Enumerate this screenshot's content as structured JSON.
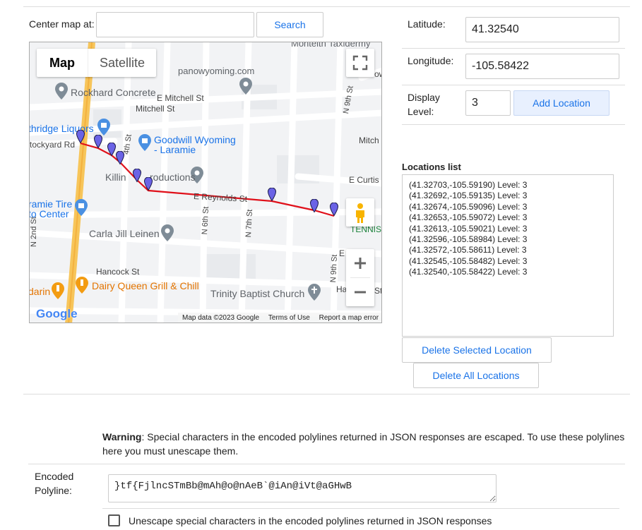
{
  "search": {
    "label": "Center map at:",
    "value": "",
    "button": "Search"
  },
  "map": {
    "tabs": [
      "Map",
      "Satellite"
    ],
    "places": [
      "Monteith Taxidermy",
      "panowyoming.com",
      "Rockhard Concrete",
      "E Mitchell St",
      "Mitchell St",
      "Goodwill Wyoming",
      "- Laramie",
      "thridge Liquors",
      "tockyard Rd",
      "Killin",
      "roductions",
      "E Curtis",
      "E Reynolds St",
      "ramie Tire",
      "to Center",
      "Carla Jill Leinen",
      "Hancock St",
      "Dairy Queen Grill & Chill",
      "darin",
      "Trinity Baptist Church",
      "TENNIS",
      "N 9th St",
      "N 6th St",
      "N 7th St",
      "N 9th St",
      "Mitch",
      "4th St",
      "N 2nd St",
      "E",
      "Ha",
      "St",
      "ow"
    ],
    "google_logo": "Google",
    "footer": [
      "Map data ©2023 Google",
      "Terms of Use",
      "Report a map error"
    ]
  },
  "form": {
    "lat_label": "Latitude:",
    "lat_value": "41.32540",
    "lng_label": "Longitude:",
    "lng_value": "-105.58422",
    "level_label": "Display Level:",
    "level_value": "3",
    "add_button": "Add Location"
  },
  "locations": {
    "title": "Locations list",
    "items": [
      "(41.32703,-105.59190) Level: 3",
      "(41.32692,-105.59135) Level: 3",
      "(41.32674,-105.59096) Level: 3",
      "(41.32653,-105.59072) Level: 3",
      "(41.32613,-105.59021) Level: 3",
      "(41.32596,-105.58984) Level: 3",
      "(41.32572,-105.58611) Level: 3",
      "(41.32545,-105.58482) Level: 3",
      "(41.32540,-105.58422) Level: 3"
    ],
    "delete_selected": "Delete Selected Location",
    "delete_all": "Delete All Locations"
  },
  "warning": {
    "bold": "Warning",
    "text": ": Special characters in the encoded polylines returned in JSON responses are escaped. To use these polylines here you must unescape them."
  },
  "encoded": {
    "label": "Encoded Polyline:",
    "value": "}tf{FjlncSTmBb@mAh@o@nAeB`@iAn@iVt@aGHwB"
  },
  "unescape": {
    "label": "Unescape special characters in the encoded polylines returned in JSON responses"
  },
  "colors": {
    "route": "#e0101a",
    "marker": "#6b63e6",
    "accent": "#1a73e8",
    "highway": "#f7c55a"
  }
}
